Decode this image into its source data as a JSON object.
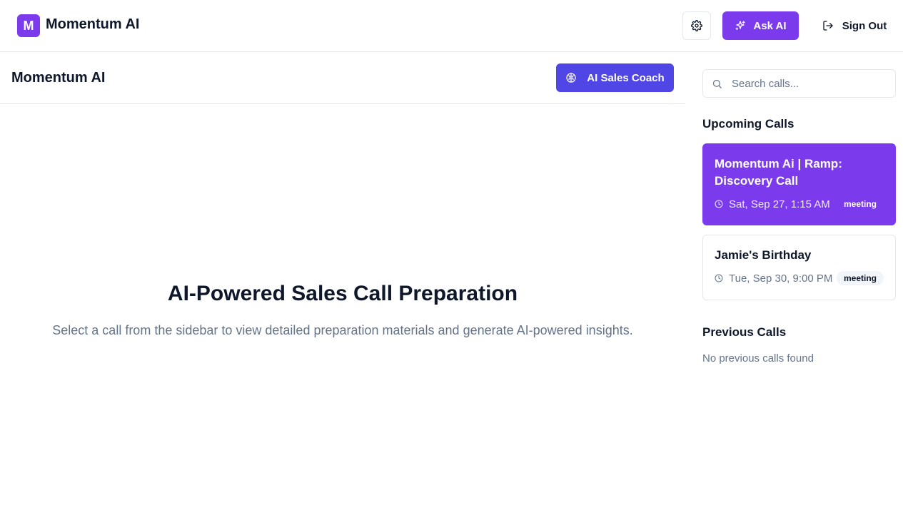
{
  "brand": {
    "logo_letter": "M",
    "name": "Momentum AI"
  },
  "topbar": {
    "settings_icon": "gear-icon",
    "ask_ai_label": "Ask AI",
    "sign_out_label": "Sign Out"
  },
  "main": {
    "title": "Momentum AI",
    "coach_button_label": "AI Sales Coach",
    "hero_title": "AI-Powered Sales Call Preparation",
    "hero_subtitle": "Select a call from the sidebar to view detailed preparation materials and generate AI-powered insights."
  },
  "sidebar": {
    "search": {
      "placeholder": "Search calls...",
      "value": ""
    },
    "upcoming_title": "Upcoming Calls",
    "upcoming_calls": [
      {
        "title": "Momentum Ai | Ramp: Discovery Call",
        "time": "Sat, Sep 27, 1:15 AM",
        "badge": "meeting",
        "selected": true
      },
      {
        "title": "Jamie's Birthday",
        "time": "Tue, Sep 30, 9:00 PM",
        "badge": "meeting",
        "selected": false
      }
    ],
    "previous_title": "Previous Calls",
    "previous_empty": "No previous calls found"
  },
  "colors": {
    "accent": "#7c3aed",
    "coach": "#4f46e5",
    "muted_text": "#64748b",
    "border": "#e5e7eb"
  }
}
